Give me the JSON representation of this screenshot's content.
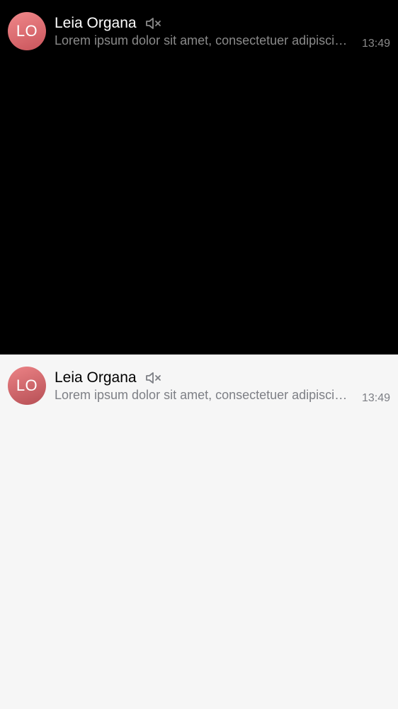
{
  "chat_list_dark": {
    "item": {
      "avatar_initials": "LO",
      "name": "Leia Organa",
      "muted_icon": "speaker-muted-icon",
      "preview": "Lorem ipsum dolor sit amet, consectetuer adipiscing elit.",
      "time": "13:49"
    }
  },
  "chat_list_light": {
    "item": {
      "avatar_initials": "LO",
      "name": "Leia Organa",
      "muted_icon": "speaker-muted-icon",
      "preview": "Lorem ipsum dolor sit amet, consectetuer adipiscing elit.",
      "time": "13:49"
    }
  },
  "colors": {
    "dark_background": "#000000",
    "light_background": "#f6f6f6",
    "avatar_accent": "#e0767b",
    "secondary_text_dark": "#8a8a8a",
    "secondary_text_light": "#7d7f85"
  }
}
